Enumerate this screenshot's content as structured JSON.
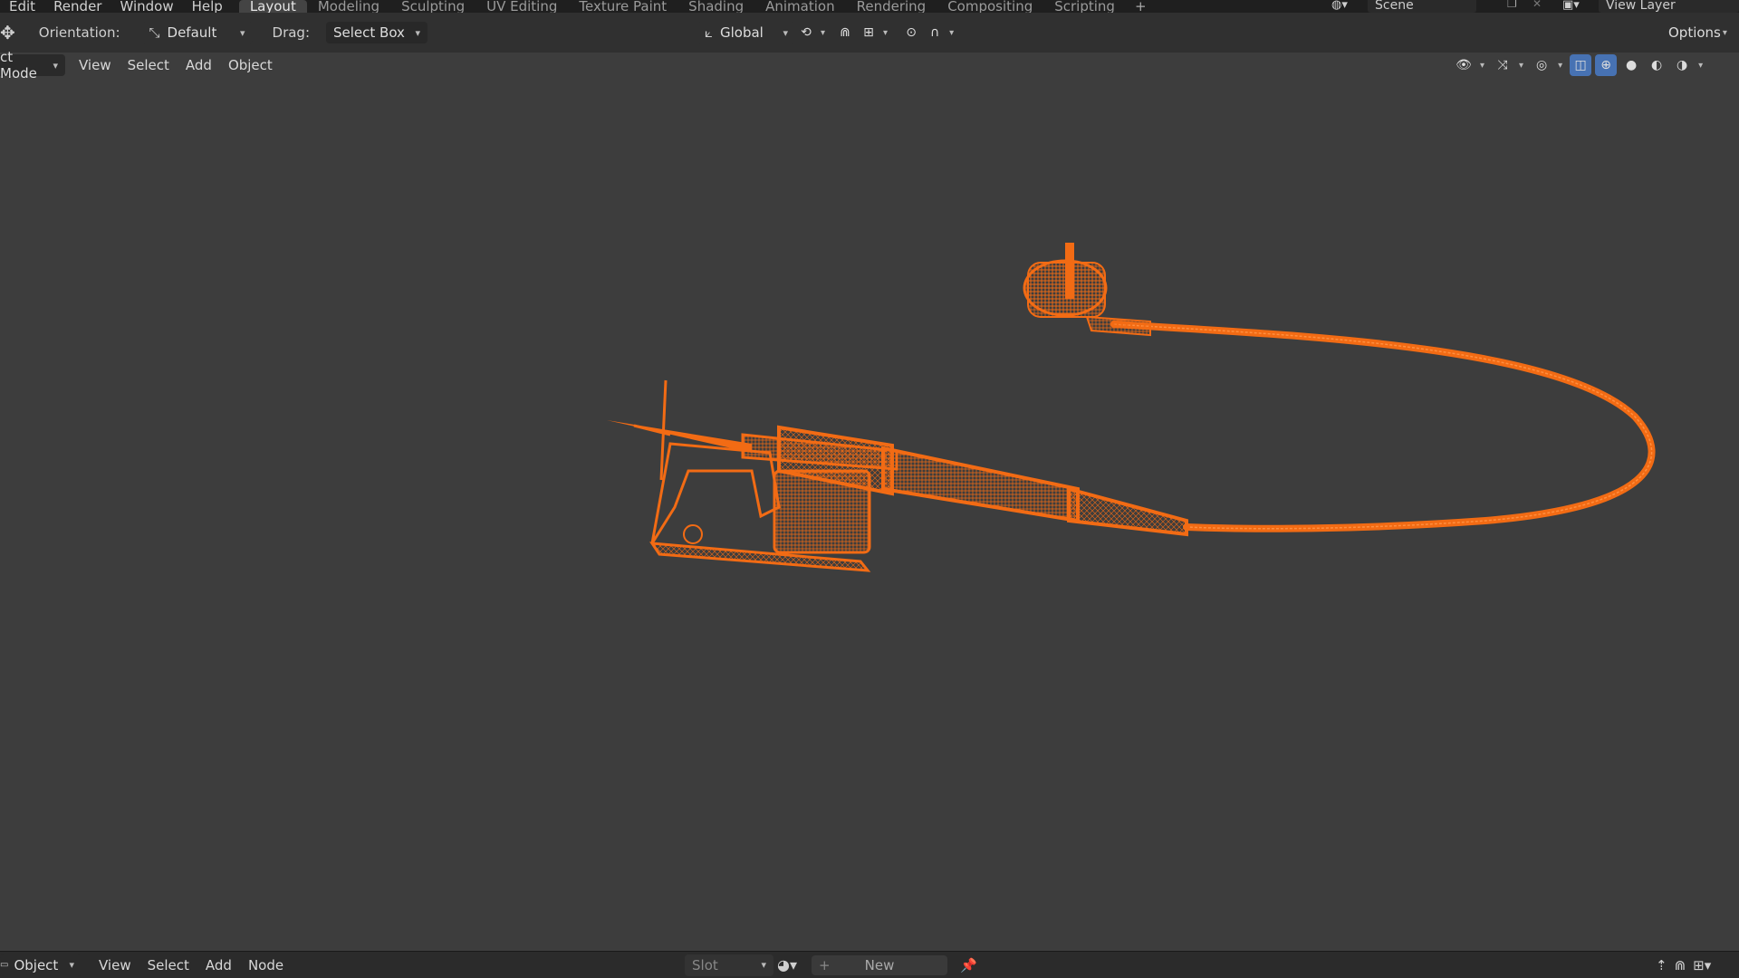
{
  "topbar": {
    "menus": [
      "Edit",
      "Render",
      "Window",
      "Help"
    ],
    "workspaces": [
      {
        "label": "Layout",
        "active": true
      },
      {
        "label": "Modeling",
        "active": false
      },
      {
        "label": "Sculpting",
        "active": false
      },
      {
        "label": "UV Editing",
        "active": false
      },
      {
        "label": "Texture Paint",
        "active": false
      },
      {
        "label": "Shading",
        "active": false
      },
      {
        "label": "Animation",
        "active": false
      },
      {
        "label": "Rendering",
        "active": false
      },
      {
        "label": "Compositing",
        "active": false
      },
      {
        "label": "Scripting",
        "active": false
      }
    ],
    "add_workspace": "+",
    "scene_name": "Scene",
    "view_layer_name": "View Layer"
  },
  "toolbar": {
    "orientation_label": "Orientation:",
    "orientation_value": "Default",
    "drag_label": "Drag:",
    "drag_value": "Select Box",
    "transform_orientation": "Global",
    "options_label": "Options"
  },
  "viewport_header": {
    "mode": "ct Mode",
    "menus": [
      "View",
      "Select",
      "Add",
      "Object"
    ]
  },
  "bottombar": {
    "mode": "Object",
    "menus": [
      "View",
      "Select",
      "Add",
      "Node"
    ],
    "slot_label": "Slot",
    "new_label": "New"
  },
  "colors": {
    "selection_orange": "#f26b14",
    "active_blue": "#4772b3",
    "viewport_bg": "#3d3d3d"
  },
  "icons": [
    "move-tool-icon",
    "orientation-icon",
    "global-axes-icon",
    "pivot-icon",
    "snap-icon",
    "snap-increment-icon",
    "proportional-edit-icon",
    "falloff-icon",
    "visibility-icon",
    "gizmo-icon",
    "overlay-icon",
    "xray-icon",
    "wireframe-shading-icon",
    "solid-shading-icon",
    "material-shading-icon",
    "rendered-shading-icon",
    "material-sphere-icon",
    "pin-icon"
  ]
}
